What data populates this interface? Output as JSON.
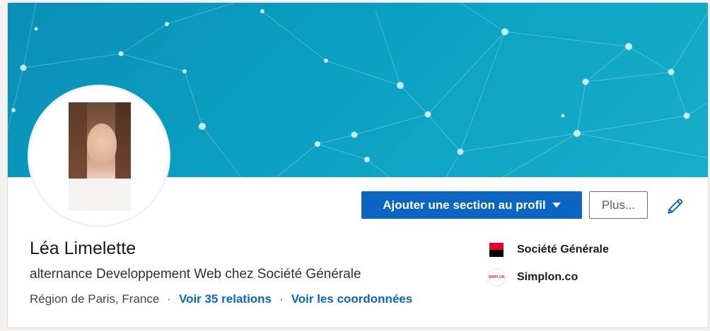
{
  "profile": {
    "name": "Léa Limelette",
    "headline": "alternance Developpement Web chez Société Générale",
    "location": "Région de Paris, France",
    "separator": "·",
    "connections_link": "Voir 35 relations",
    "contact_link": "Voir les coordonnées"
  },
  "actions": {
    "add_section_label": "Ajouter une section au profil",
    "more_label": "Plus...",
    "edit_icon": "pencil-icon",
    "dropdown_icon": "caret-down-icon"
  },
  "companies": [
    {
      "name": "Société Générale",
      "logo": "societe-generale-logo"
    },
    {
      "name": "Simplon.co",
      "logo": "simplon-logo",
      "logo_text": "SIMPLON"
    }
  ],
  "colors": {
    "accent": "#0a66c2",
    "banner_start": "#0a8fb6",
    "banner_end": "#16aeca",
    "sg_red": "#e60028",
    "sg_black": "#000000"
  }
}
